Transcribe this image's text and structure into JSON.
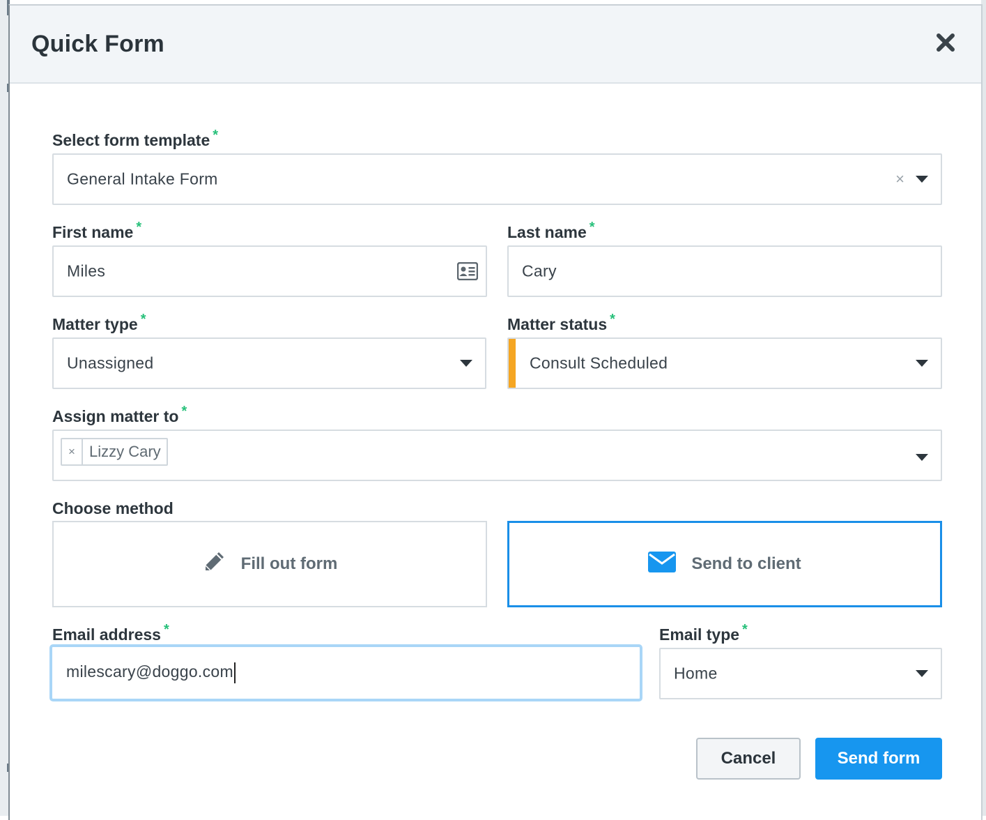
{
  "modal": {
    "title": "Quick Form",
    "close_icon": "close-icon"
  },
  "form": {
    "template": {
      "label": "Select form template",
      "required": "*",
      "value": "General Intake Form",
      "clear": "×"
    },
    "first_name": {
      "label": "First name",
      "required": "*",
      "value": "Miles",
      "icon": "contact-card-icon"
    },
    "last_name": {
      "label": "Last name",
      "required": "*",
      "value": "Cary"
    },
    "matter_type": {
      "label": "Matter type",
      "required": "*",
      "value": "Unassigned"
    },
    "matter_status": {
      "label": "Matter status",
      "required": "*",
      "value": "Consult Scheduled",
      "status_color": "#f5a623"
    },
    "assign_matter": {
      "label": "Assign matter to",
      "required": "*",
      "chips": [
        {
          "remove": "×",
          "label": "Lizzy Cary"
        }
      ]
    },
    "method": {
      "label": "Choose method",
      "options": [
        {
          "label": "Fill out form",
          "icon": "pencil-icon",
          "selected": false
        },
        {
          "label": "Send to client",
          "icon": "envelope-icon",
          "selected": true
        }
      ]
    },
    "email": {
      "label": "Email address",
      "required": "*",
      "value": "milescary@doggo.com"
    },
    "email_type": {
      "label": "Email type",
      "required": "*",
      "value": "Home"
    }
  },
  "actions": {
    "cancel_label": "Cancel",
    "send_label": "Send form"
  },
  "colors": {
    "accent": "#1796ef",
    "required": "#27c07a",
    "selected_border": "#1a8fe8",
    "focus_ring": "#a9d6f7"
  }
}
